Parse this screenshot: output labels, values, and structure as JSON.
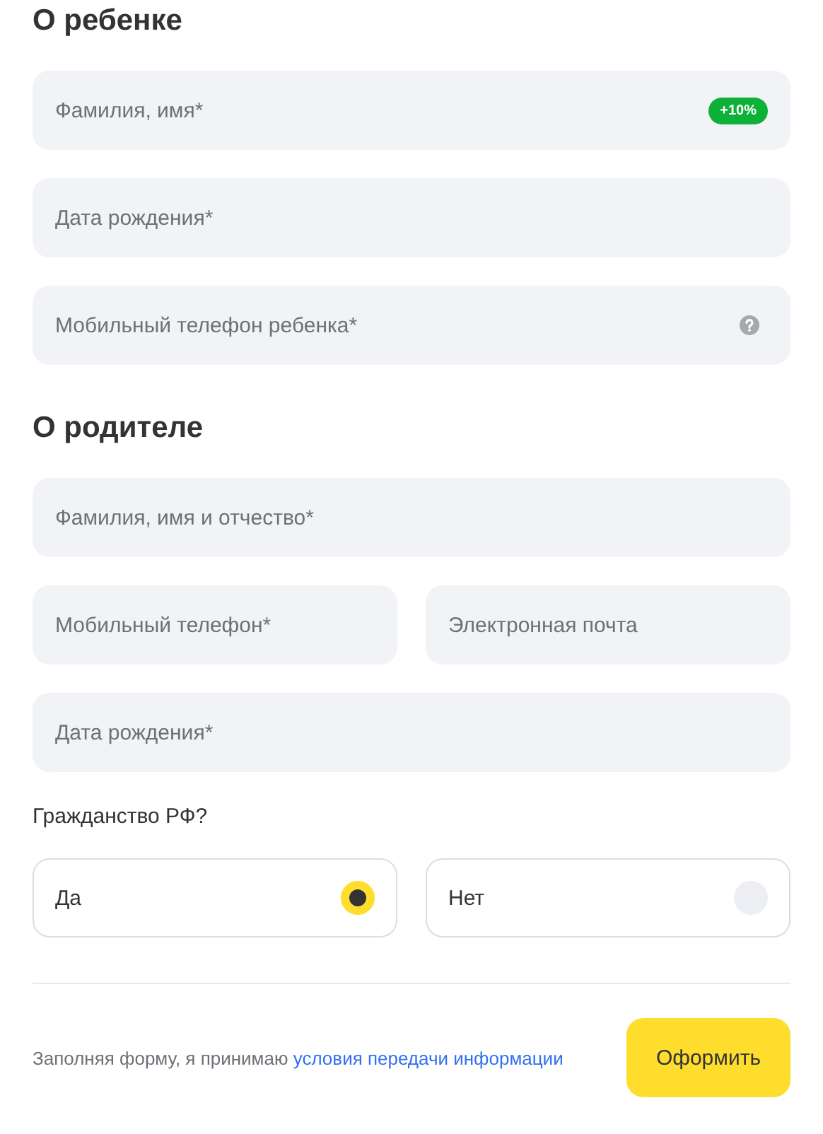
{
  "sections": [
    {
      "title": "О ребенке",
      "rows": [
        [
          {
            "placeholder": "Фамилия, имя*",
            "badge": "+10%",
            "help": false
          }
        ],
        [
          {
            "placeholder": "Дата рождения*",
            "help": false
          }
        ],
        [
          {
            "placeholder": "Мобильный телефон ребенка*",
            "help": true
          }
        ]
      ]
    },
    {
      "title": "О родителе",
      "rows": [
        [
          {
            "placeholder": "Фамилия, имя и отчество*",
            "help": false
          }
        ],
        [
          {
            "placeholder": "Мобильный телефон*",
            "help": false
          },
          {
            "placeholder": "Электронная почта",
            "help": false
          }
        ],
        [
          {
            "placeholder": "Дата рождения*",
            "help": false
          }
        ]
      ]
    }
  ],
  "citizenship": {
    "question": "Гражданство РФ?",
    "options": [
      {
        "label": "Да",
        "selected": true
      },
      {
        "label": "Нет",
        "selected": false
      }
    ]
  },
  "footer": {
    "consent": "Заполняя форму, я принимаю",
    "link": "условия передачи информации",
    "button": "Оформить"
  }
}
